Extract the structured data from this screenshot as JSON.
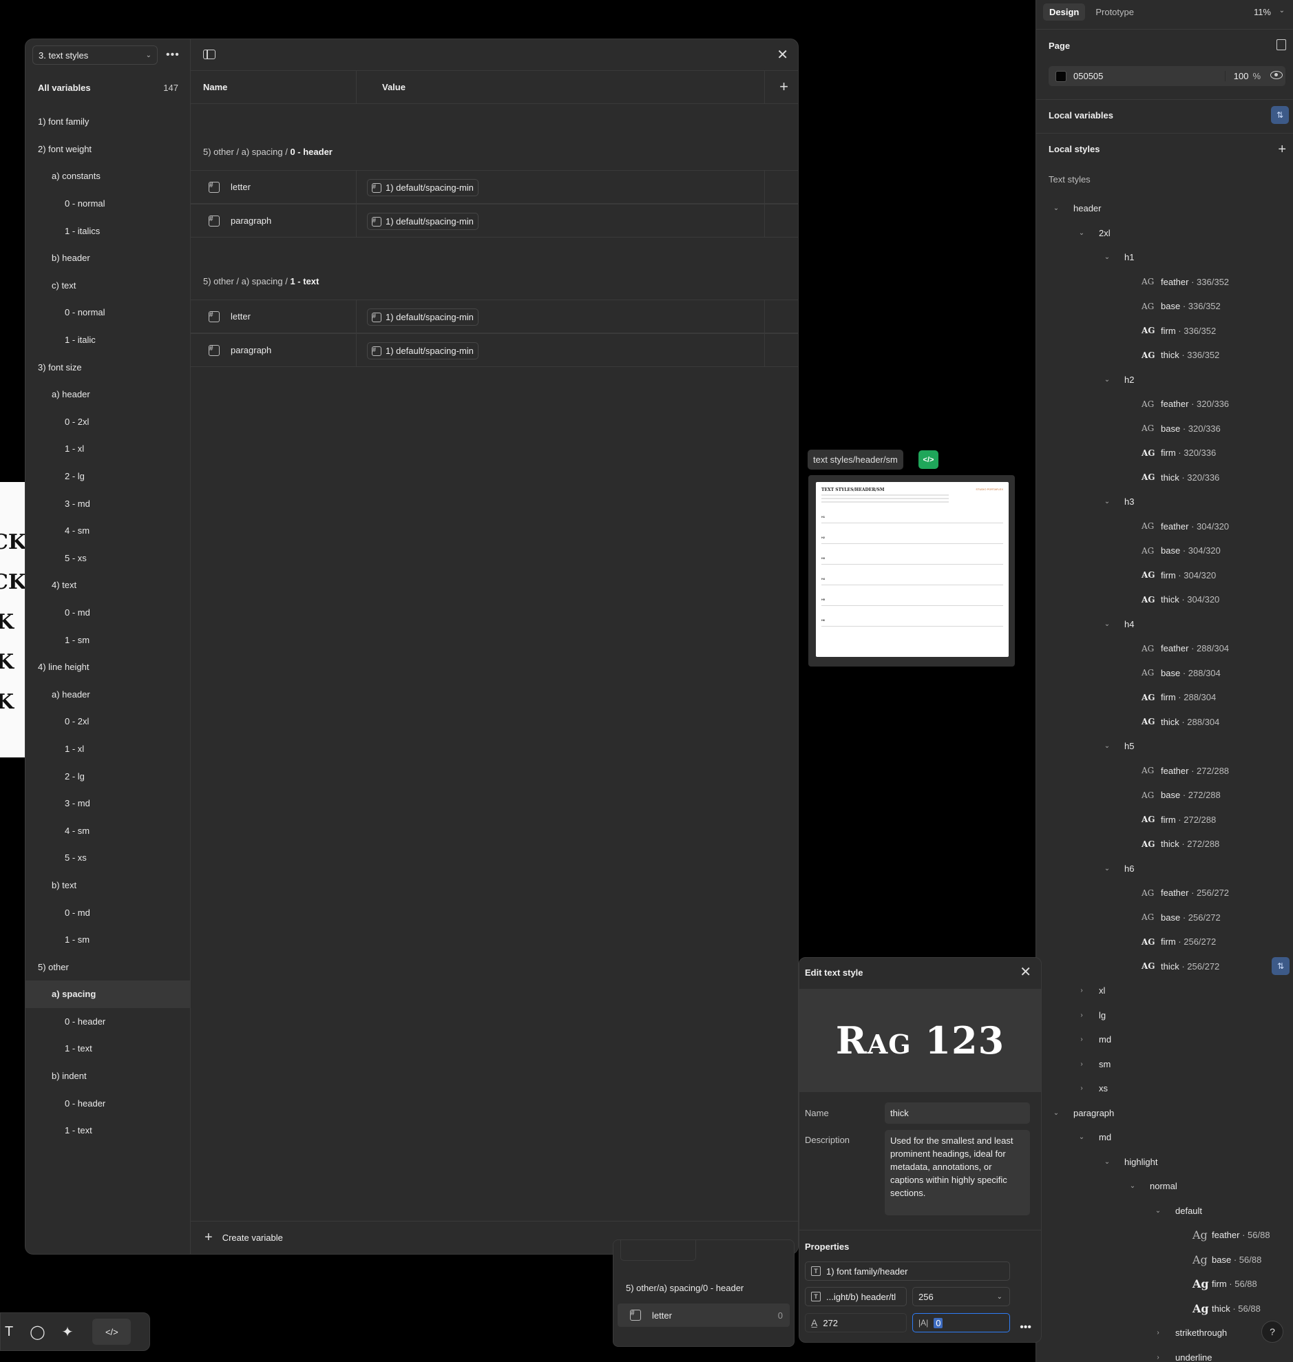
{
  "collection_select": "3. text styles",
  "all_variables": {
    "label": "All variables",
    "count": "147"
  },
  "groups": [
    {
      "label": "1) font family",
      "level": 0
    },
    {
      "label": "2) font weight",
      "level": 0
    },
    {
      "label": "a) constants",
      "level": 1
    },
    {
      "label": "0 - normal",
      "level": 2
    },
    {
      "label": "1 - italics",
      "level": 2
    },
    {
      "label": "b) header",
      "level": 1
    },
    {
      "label": "c) text",
      "level": 1
    },
    {
      "label": "0 - normal",
      "level": 2
    },
    {
      "label": "1 - italic",
      "level": 2
    },
    {
      "label": "3) font size",
      "level": 0
    },
    {
      "label": "a) header",
      "level": 1
    },
    {
      "label": "0 - 2xl",
      "level": 2
    },
    {
      "label": "1 - xl",
      "level": 2
    },
    {
      "label": "2 - lg",
      "level": 2
    },
    {
      "label": "3 - md",
      "level": 2
    },
    {
      "label": "4 - sm",
      "level": 2
    },
    {
      "label": "5 - xs",
      "level": 2
    },
    {
      "label": "4) text",
      "level": 1
    },
    {
      "label": "0 - md",
      "level": 2
    },
    {
      "label": "1 - sm",
      "level": 2
    },
    {
      "label": "4) line height",
      "level": 0
    },
    {
      "label": "a) header",
      "level": 1
    },
    {
      "label": "0 - 2xl",
      "level": 2
    },
    {
      "label": "1 - xl",
      "level": 2
    },
    {
      "label": "2 - lg",
      "level": 2
    },
    {
      "label": "3 - md",
      "level": 2
    },
    {
      "label": "4 - sm",
      "level": 2
    },
    {
      "label": "5 - xs",
      "level": 2
    },
    {
      "label": "b) text",
      "level": 1
    },
    {
      "label": "0 - md",
      "level": 2
    },
    {
      "label": "1 - sm",
      "level": 2
    },
    {
      "label": "5) other",
      "level": 0
    },
    {
      "label": "a) spacing",
      "level": 1,
      "selected": true
    },
    {
      "label": "0 - header",
      "level": 2
    },
    {
      "label": "1 - text",
      "level": 2
    },
    {
      "label": "b) indent",
      "level": 1
    },
    {
      "label": "0 - header",
      "level": 2
    },
    {
      "label": "1 - text",
      "level": 2
    }
  ],
  "table": {
    "name_header": "Name",
    "value_header": "Value",
    "sections": [
      {
        "path": "5) other / a) spacing / ",
        "bold": "0 - header",
        "rows": [
          {
            "name": "letter",
            "value": "1) default/spacing-min"
          },
          {
            "name": "paragraph",
            "value": "1) default/spacing-min"
          }
        ]
      },
      {
        "path": "5) other / a) spacing / ",
        "bold": "1 - text",
        "rows": [
          {
            "name": "letter",
            "value": "1) default/spacing-min"
          },
          {
            "name": "paragraph",
            "value": "1) default/spacing-min"
          }
        ]
      }
    ],
    "create_label": "Create variable"
  },
  "canvas": {
    "left_glyphs": [
      "CK",
      "CK",
      "K",
      "K",
      "K"
    ],
    "frame_label": "text styles/header/sm",
    "frame_badge": "</>",
    "frame_doc_title": "TEXT STYLES/HEADER/SM",
    "frame_doc_brand": "STUDIO PORTAFLEX",
    "frame_doc_sections": [
      "H1",
      "H2",
      "H3",
      "H4",
      "H5",
      "H6"
    ]
  },
  "right_panel": {
    "tabs": [
      "Design",
      "Prototype"
    ],
    "zoom": "11%",
    "page_label": "Page",
    "page_color": "050505",
    "page_opacity": "100",
    "page_opacity_unit": "%",
    "local_variables": "Local variables",
    "local_styles": "Local styles",
    "text_styles": "Text styles",
    "tree": [
      {
        "label": "header",
        "indent": 0,
        "chev": "v"
      },
      {
        "label": "2xl",
        "indent": 1,
        "chev": "v"
      },
      {
        "label": "h1",
        "indent": 2,
        "chev": "v"
      },
      {
        "style": "feather",
        "value": "336/352",
        "indent": 3,
        "weight": "light"
      },
      {
        "style": "base",
        "value": "336/352",
        "indent": 3,
        "weight": "light"
      },
      {
        "style": "firm",
        "value": "336/352",
        "indent": 3,
        "weight": "bold"
      },
      {
        "style": "thick",
        "value": "336/352",
        "indent": 3,
        "weight": "bold"
      },
      {
        "label": "h2",
        "indent": 2,
        "chev": "v"
      },
      {
        "style": "feather",
        "value": "320/336",
        "indent": 3,
        "weight": "light"
      },
      {
        "style": "base",
        "value": "320/336",
        "indent": 3,
        "weight": "light"
      },
      {
        "style": "firm",
        "value": "320/336",
        "indent": 3,
        "weight": "bold"
      },
      {
        "style": "thick",
        "value": "320/336",
        "indent": 3,
        "weight": "bold"
      },
      {
        "label": "h3",
        "indent": 2,
        "chev": "v"
      },
      {
        "style": "feather",
        "value": "304/320",
        "indent": 3,
        "weight": "light"
      },
      {
        "style": "base",
        "value": "304/320",
        "indent": 3,
        "weight": "light"
      },
      {
        "style": "firm",
        "value": "304/320",
        "indent": 3,
        "weight": "bold"
      },
      {
        "style": "thick",
        "value": "304/320",
        "indent": 3,
        "weight": "bold"
      },
      {
        "label": "h4",
        "indent": 2,
        "chev": "v"
      },
      {
        "style": "feather",
        "value": "288/304",
        "indent": 3,
        "weight": "light"
      },
      {
        "style": "base",
        "value": "288/304",
        "indent": 3,
        "weight": "light"
      },
      {
        "style": "firm",
        "value": "288/304",
        "indent": 3,
        "weight": "bold"
      },
      {
        "style": "thick",
        "value": "288/304",
        "indent": 3,
        "weight": "bold"
      },
      {
        "label": "h5",
        "indent": 2,
        "chev": "v"
      },
      {
        "style": "feather",
        "value": "272/288",
        "indent": 3,
        "weight": "light"
      },
      {
        "style": "base",
        "value": "272/288",
        "indent": 3,
        "weight": "light"
      },
      {
        "style": "firm",
        "value": "272/288",
        "indent": 3,
        "weight": "bold"
      },
      {
        "style": "thick",
        "value": "272/288",
        "indent": 3,
        "weight": "bold"
      },
      {
        "label": "h6",
        "indent": 2,
        "chev": "v"
      },
      {
        "style": "feather",
        "value": "256/272",
        "indent": 3,
        "weight": "light"
      },
      {
        "style": "base",
        "value": "256/272",
        "indent": 3,
        "weight": "light"
      },
      {
        "style": "firm",
        "value": "256/272",
        "indent": 3,
        "weight": "bold"
      },
      {
        "style": "thick",
        "value": "256/272",
        "indent": 3,
        "weight": "bold",
        "badge": true
      },
      {
        "label": "xl",
        "indent": 1,
        "chev": ">"
      },
      {
        "label": "lg",
        "indent": 1,
        "chev": ">"
      },
      {
        "label": "md",
        "indent": 1,
        "chev": ">"
      },
      {
        "label": "sm",
        "indent": 1,
        "chev": ">"
      },
      {
        "label": "xs",
        "indent": 1,
        "chev": ">"
      },
      {
        "label": "paragraph",
        "indent": 0,
        "chev": "v"
      },
      {
        "label": "md",
        "indent": 1,
        "chev": "v"
      },
      {
        "label": "highlight",
        "indent": 2,
        "chev": "v"
      },
      {
        "label": "normal",
        "indent": 3,
        "chev": "v"
      },
      {
        "label": "default",
        "indent": 4,
        "chev": "v"
      },
      {
        "style": "feather",
        "value": "56/88",
        "indent": 5,
        "weight": "light",
        "ag": "Ag"
      },
      {
        "style": "base",
        "value": "56/88",
        "indent": 5,
        "weight": "light",
        "ag": "Ag"
      },
      {
        "style": "firm",
        "value": "56/88",
        "indent": 5,
        "weight": "bold",
        "ag": "Ag"
      },
      {
        "style": "thick",
        "value": "56/88",
        "indent": 5,
        "weight": "bold",
        "ag": "Ag"
      },
      {
        "label": "strikethrough",
        "indent": 4,
        "chev": ">"
      },
      {
        "label": "underline",
        "indent": 4,
        "chev": ">"
      }
    ],
    "help": "?"
  },
  "edit_style": {
    "title": "Edit text style",
    "preview": "Rag 123",
    "name_label": "Name",
    "name_value": "thick",
    "description_label": "Description",
    "description_value": "Used for the smallest and least prominent headings, ideal for metadata, annotations, or captions within highly specific sections.",
    "properties_label": "Properties",
    "font_family": "1) font family/header",
    "font_weight": "...ight/b) header/tl",
    "font_size": "256",
    "line_height": "272",
    "letter_spacing": "0"
  },
  "behind_panel": {
    "title": "5) other/a) spacing/0 - header",
    "row_name": "letter",
    "row_value": "0"
  },
  "toolbar": {
    "code_label": "</>"
  }
}
